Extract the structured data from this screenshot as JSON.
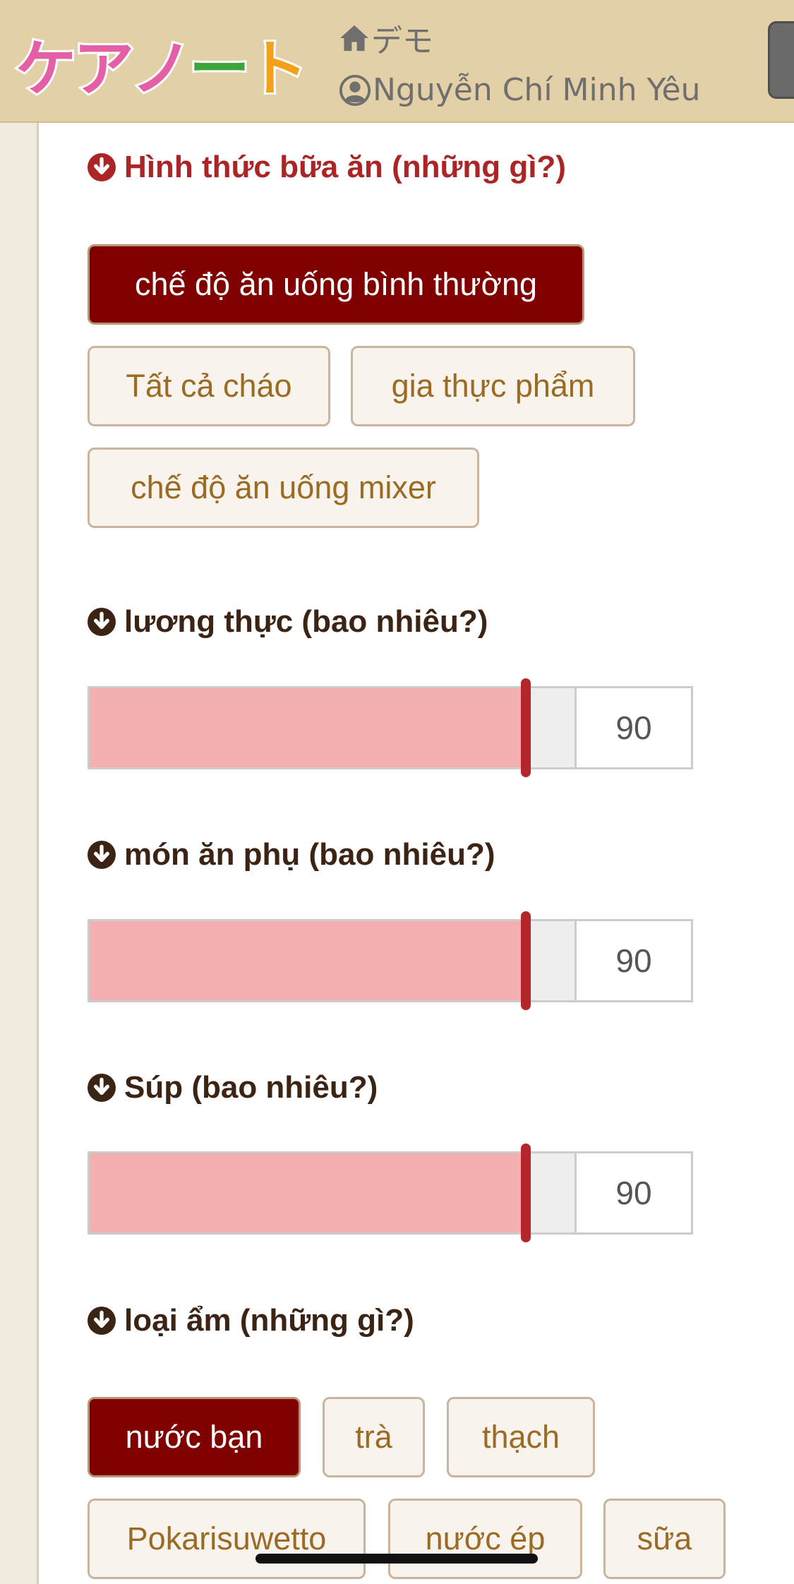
{
  "header": {
    "logo_text": "ケアノート",
    "home_label": "デモ",
    "user_name": "Nguyễn Chí Minh Yêu",
    "menu_icon": "hamburger-menu-icon"
  },
  "sections": {
    "meal_form": {
      "title": "Hình thức bữa ăn (những gì?)",
      "options": [
        "chế độ ăn uống bình thường",
        "Tất cả cháo",
        "gia thực phẩm",
        "chế độ ăn uống mixer"
      ],
      "selected": "chế độ ăn uống bình thường"
    },
    "staple": {
      "title": "lương thực (bao nhiêu?)",
      "value": "90",
      "max": 100
    },
    "side_dish": {
      "title": "món ăn phụ (bao nhiêu?)",
      "value": "90",
      "max": 100
    },
    "soup": {
      "title": "Súp (bao nhiêu?)",
      "value": "90",
      "max": 100
    },
    "drink_type": {
      "title": "loại ẩm (những gì?)",
      "options": [
        "nước bạn",
        "trà",
        "thạch",
        "Pokarisuwetto",
        "nước ép",
        "sữa"
      ],
      "selected": "nước bạn"
    }
  },
  "colors": {
    "header_bg": "#e3d0a6",
    "selected_chip": "#800000",
    "slider_fill": "#f4aeaf",
    "slider_handle": "#b5262b",
    "title_red": "#ab2426",
    "title_brown": "#3c2415"
  }
}
